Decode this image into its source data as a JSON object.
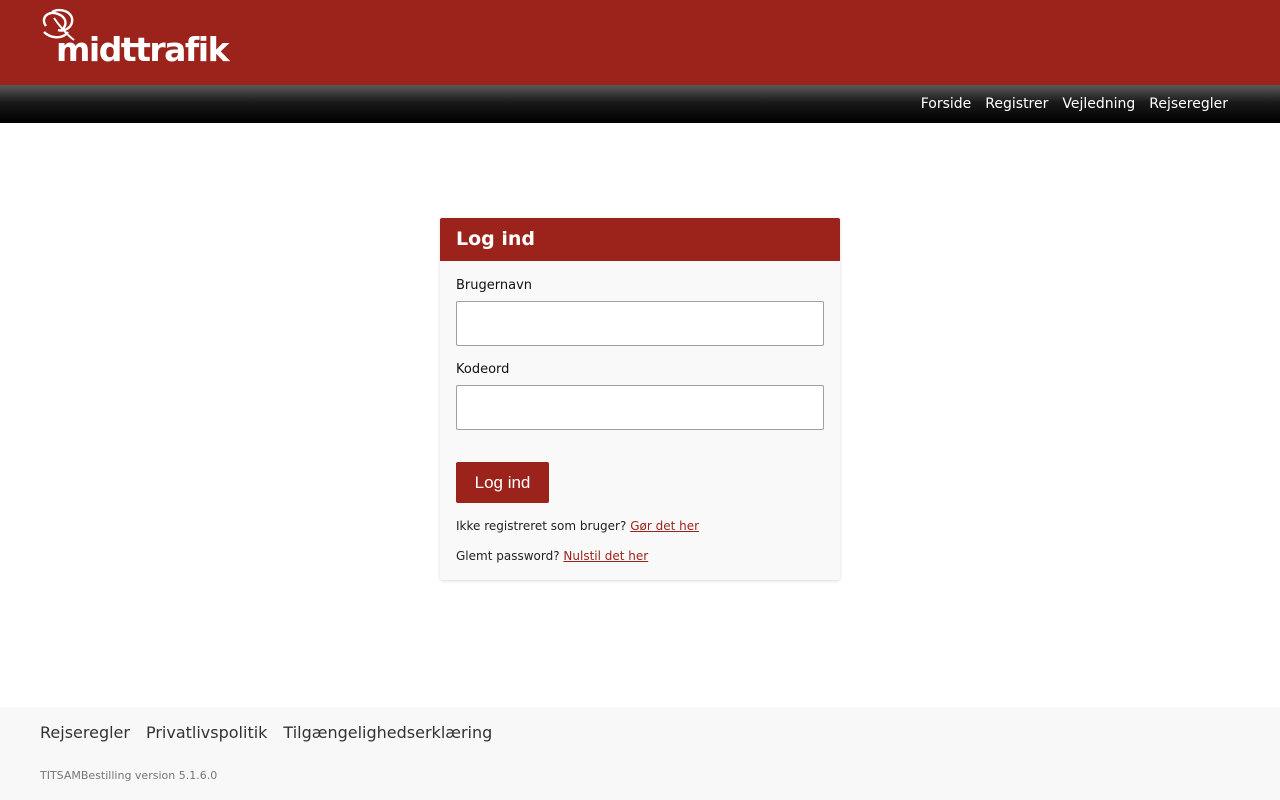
{
  "brand": {
    "name": "midttrafik",
    "color": "#9b231c"
  },
  "nav": {
    "items": [
      {
        "label": "Forside"
      },
      {
        "label": "Registrer"
      },
      {
        "label": "Vejledning"
      },
      {
        "label": "Rejseregler"
      }
    ]
  },
  "login": {
    "title": "Log ind",
    "username_label": "Brugernavn",
    "username_value": "",
    "password_label": "Kodeord",
    "password_value": "",
    "submit_label": "Log ind",
    "register_prompt": "Ikke registreret som bruger?",
    "register_link": "Gør det her",
    "forgot_prompt": "Glemt password?",
    "forgot_link": "Nulstil det her"
  },
  "footer": {
    "links": [
      {
        "label": "Rejseregler"
      },
      {
        "label": "Privatlivspolitik"
      },
      {
        "label": "Tilgængelighedserklæring"
      }
    ],
    "version": "TITSAMBestilling version 5.1.6.0"
  }
}
